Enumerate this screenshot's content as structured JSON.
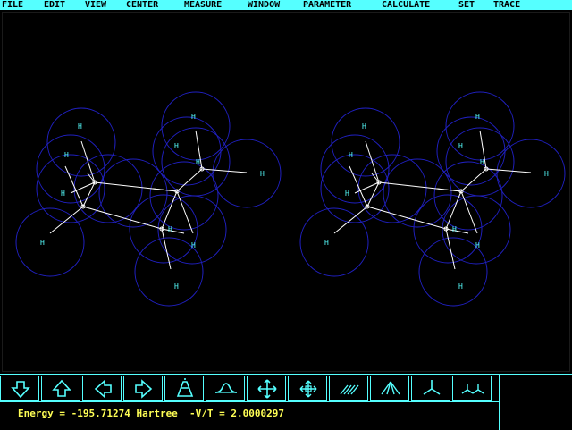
{
  "menu": {
    "items": [
      {
        "label": "FILE"
      },
      {
        "label": "EDIT"
      },
      {
        "label": "VIEW"
      },
      {
        "label": "CENTER"
      },
      {
        "label": "MEASURE"
      },
      {
        "label": "WINDOW"
      },
      {
        "label": "PARAMETER"
      },
      {
        "label": "CALCULATE"
      },
      {
        "label": "SET"
      },
      {
        "label": "TRACE"
      }
    ]
  },
  "viewport": {
    "atom_label": "H",
    "colors": {
      "sphere": "#2020c0",
      "bond": "#ffffff",
      "label": "#55ffff",
      "background": "#000000"
    }
  },
  "toolbar": {
    "buttons": [
      {
        "icon": "arrow-down-icon"
      },
      {
        "icon": "arrow-up-icon"
      },
      {
        "icon": "arrow-left-icon"
      },
      {
        "icon": "arrow-right-icon"
      },
      {
        "icon": "rotate-x-icon"
      },
      {
        "icon": "rotate-y-icon"
      },
      {
        "icon": "translate-icon"
      },
      {
        "icon": "zoom-icon"
      },
      {
        "icon": "hatch-icon"
      },
      {
        "icon": "fan-icon"
      },
      {
        "icon": "tripod-icon"
      },
      {
        "icon": "double-tripod-icon"
      }
    ]
  },
  "status": {
    "text": "Energy = -195.71274 Hartree  -V/T = 2.0000297",
    "color": "#ffff55"
  },
  "theme": {
    "menu_bg": "#55ffff",
    "menu_fg": "#000000",
    "accent": "#55ffff"
  }
}
